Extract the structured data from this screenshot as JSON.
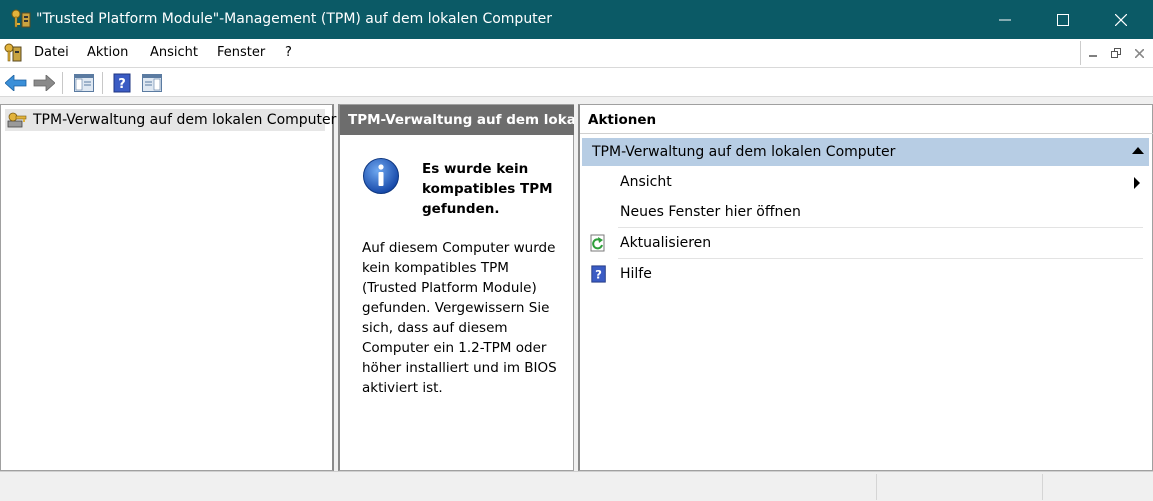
{
  "window": {
    "title": "\"Trusted Platform Module\"-Management (TPM) auf dem lokalen Computer",
    "title_bar_color": "#0b5a66",
    "controls": {
      "minimize_icon": "minimize-icon",
      "maximize_icon": "maximize-icon",
      "close_icon": "close-icon"
    }
  },
  "menu": {
    "items": [
      "Datei",
      "Aktion",
      "Ansicht",
      "Fenster",
      "?"
    ]
  },
  "toolbar": {
    "buttons": [
      "back-arrow-icon",
      "forward-arrow-icon",
      "show-hide-console-tree-icon",
      "help-icon",
      "show-hide-action-pane-icon"
    ]
  },
  "tree": {
    "root_label": "TPM-Verwaltung auf dem lokalen Computer"
  },
  "center": {
    "header": "TPM-Verwaltung auf dem loka...",
    "info_heading": "Es wurde kein kompatibles TPM gefunden.",
    "info_body": "Auf diesem Computer wurde kein kompatibles TPM (Trusted Platform Module) gefunden. Vergewissern Sie sich, dass auf diesem Computer ein 1.2-TPM oder höher installiert und im BIOS aktiviert ist."
  },
  "actions": {
    "header": "Aktionen",
    "group_label": "TPM-Verwaltung auf dem lokalen Computer",
    "group_color": "#b7cde4",
    "items": [
      {
        "label": "Ansicht",
        "icon": "",
        "has_submenu": true
      },
      {
        "label": "Neues Fenster hier öffnen",
        "icon": ""
      },
      {
        "label": "Aktualisieren",
        "icon": "refresh-icon"
      },
      {
        "label": "Hilfe",
        "icon": "help-icon"
      }
    ]
  }
}
